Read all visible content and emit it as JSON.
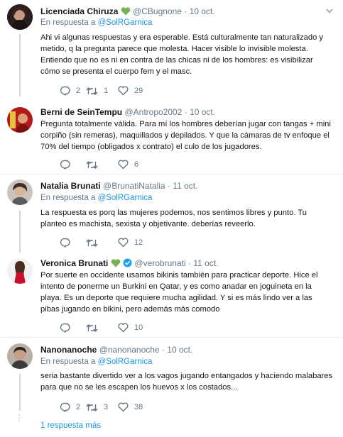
{
  "tweets": [
    {
      "name": "Licenciada Chiruza",
      "handle": "@CBugnone",
      "sep": "·",
      "date": "10 oct.",
      "reply_prefix": "En respuesta a",
      "reply_user": "@SolRGarnica",
      "text": "Ahi vi algunas respuestas y era esperable. Está culturalmente tan naturalizado y metido, q la pregunta parece que molesta. Hacer visible lo invisible molesta. Entiendo que no es ni en contra de las chicas ni de los hombres: es visibilizar cómo se presenta el cuerpo fem y el masc.",
      "replies": "2",
      "retweets": "1",
      "likes": "29"
    },
    {
      "name": "Berni de SeinTempu",
      "handle": "@Antropo2002",
      "sep": "·",
      "date": "10 oct.",
      "text": "Pregunta totalmente válida. Para mí los hombres deberían jugar con tangas + mini corpiño (sin remeras), maquillados y depilados. Y que la cámaras de tv enfoque el 70% del tiempo (obligados x contrato) el culo de los jugadores.",
      "replies": "",
      "retweets": "",
      "likes": "6"
    },
    {
      "name": "Natalia Brunati",
      "handle": "@BrunatiNatalia",
      "sep": "·",
      "date": "11 oct.",
      "reply_prefix": "En respuesta a",
      "reply_user": "@SolRGarnica",
      "text": "La respuesta es porq las mujeres podemos, nos sentimos libres y punto. Tu planteo es machista, sexista y objetivante. deberías reveerlo.",
      "replies": "",
      "retweets": "",
      "likes": "12"
    },
    {
      "name": "Veronica Brunati",
      "handle": "@verobrunati",
      "sep": "·",
      "date": "11 oct.",
      "text": "Por suerte en occidente usamos bikinis también para practicar deporte. Hice el intento de ponerme un Burkini en Qatar, y es como anadar en joguineta en la playa. Es un deporte que requiere mucha agilidad. Y si es más lindo ver a las pibas jugando en bikini, pero además más comodo",
      "replies": "",
      "retweets": "",
      "likes": "10"
    },
    {
      "name": "Nanonanoche",
      "handle": "@nanonanoche",
      "sep": "·",
      "date": "10 oct.",
      "reply_prefix": "En respuesta a",
      "reply_user": "@SolRGarnica",
      "text": "seria bastante divertido ver a los vagos jugando entangados y haciendo malabares para que no se les escapen los huevos x los costados...",
      "replies": "2",
      "retweets": "3",
      "likes": "38"
    }
  ],
  "more_replies": "1 respuesta más",
  "colors": {
    "link": "#1b95e0",
    "muted": "#657786",
    "heart_green": "#77b255",
    "verified": "#1da1f2",
    "divider": "#e6ecf0"
  },
  "icons": [
    "reply-icon",
    "retweet-icon",
    "like-icon",
    "green-heart-icon",
    "verified-badge-icon",
    "chevron-down-icon"
  ]
}
